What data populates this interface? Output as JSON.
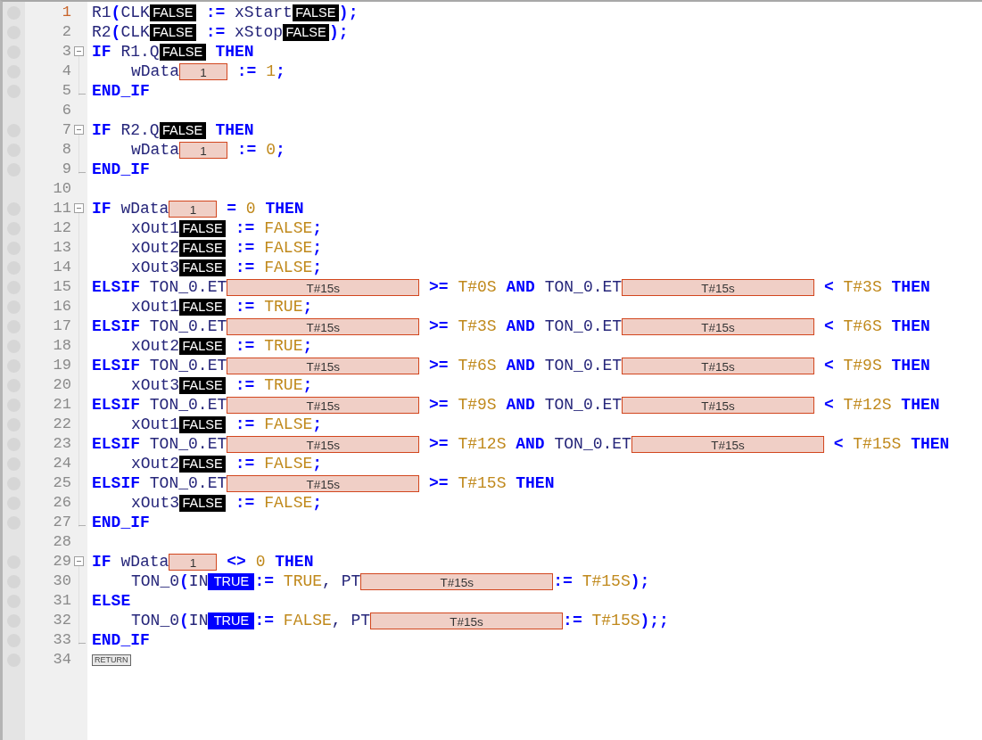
{
  "lines": [
    {
      "number": "1",
      "current": true,
      "kind": "plain",
      "indented": false,
      "tokens": [
        {
          "kind": "id",
          "text": "R1"
        },
        {
          "kind": "op",
          "text": "("
        },
        {
          "kind": "id",
          "text": "CLK"
        },
        {
          "kind": "bool",
          "text": "FALSE",
          "on": false
        },
        {
          "kind": "op",
          "text": " := "
        },
        {
          "kind": "id",
          "text": "xStart"
        },
        {
          "kind": "bool",
          "text": "FALSE",
          "on": false
        },
        {
          "kind": "op",
          "text": ");"
        }
      ]
    },
    {
      "number": "2",
      "current": false,
      "kind": "plain",
      "indented": false,
      "tokens": [
        {
          "kind": "id",
          "text": "R2"
        },
        {
          "kind": "op",
          "text": "("
        },
        {
          "kind": "id",
          "text": "CLK"
        },
        {
          "kind": "bool",
          "text": "FALSE",
          "on": false
        },
        {
          "kind": "op",
          "text": " := "
        },
        {
          "kind": "id",
          "text": "xStop"
        },
        {
          "kind": "bool",
          "text": "FALSE",
          "on": false
        },
        {
          "kind": "op",
          "text": ");"
        }
      ]
    },
    {
      "number": "3",
      "current": false,
      "kind": "open",
      "indented": false,
      "tokens": [
        {
          "kind": "kw",
          "text": "IF"
        },
        {
          "kind": "id",
          "text": " R1.Q"
        },
        {
          "kind": "bool",
          "text": "FALSE",
          "on": false
        },
        {
          "kind": "kw",
          "text": " THEN"
        }
      ]
    },
    {
      "number": "4",
      "current": false,
      "kind": "inner",
      "indented": true,
      "tokens": [
        {
          "kind": "id",
          "text": "wData"
        },
        {
          "kind": "int",
          "text": "1"
        },
        {
          "kind": "op",
          "text": " := "
        },
        {
          "kind": "lit",
          "text": "1"
        },
        {
          "kind": "op",
          "text": ";"
        }
      ]
    },
    {
      "number": "5",
      "current": false,
      "kind": "close",
      "indented": false,
      "tokens": [
        {
          "kind": "kw",
          "text": "END_IF"
        }
      ]
    },
    {
      "number": "6",
      "current": false,
      "kind": "plain"
    },
    {
      "number": "7",
      "current": false,
      "kind": "open",
      "indented": false,
      "tokens": [
        {
          "kind": "kw",
          "text": "IF"
        },
        {
          "kind": "id",
          "text": " R2.Q"
        },
        {
          "kind": "bool",
          "text": "FALSE",
          "on": false
        },
        {
          "kind": "kw",
          "text": " THEN"
        }
      ]
    },
    {
      "number": "8",
      "current": false,
      "kind": "inner",
      "indented": true,
      "tokens": [
        {
          "kind": "id",
          "text": "wData"
        },
        {
          "kind": "int",
          "text": "1"
        },
        {
          "kind": "op",
          "text": " := "
        },
        {
          "kind": "lit",
          "text": "0"
        },
        {
          "kind": "op",
          "text": ";"
        }
      ]
    },
    {
      "number": "9",
      "current": false,
      "kind": "close",
      "indented": false,
      "tokens": [
        {
          "kind": "kw",
          "text": "END_IF"
        }
      ]
    },
    {
      "number": "10",
      "current": false,
      "kind": "plain"
    },
    {
      "number": "11",
      "current": false,
      "kind": "open",
      "indented": false,
      "tokens": [
        {
          "kind": "kw",
          "text": "IF"
        },
        {
          "kind": "id",
          "text": " wData"
        },
        {
          "kind": "int",
          "text": "1"
        },
        {
          "kind": "op",
          "text": " = "
        },
        {
          "kind": "lit",
          "text": "0"
        },
        {
          "kind": "kw",
          "text": " THEN"
        }
      ]
    },
    {
      "number": "12",
      "current": false,
      "kind": "inner",
      "indented": true,
      "tokens": [
        {
          "kind": "id",
          "text": "xOut1"
        },
        {
          "kind": "bool",
          "text": "FALSE",
          "on": false
        },
        {
          "kind": "op",
          "text": " := "
        },
        {
          "kind": "lit",
          "text": "FALSE"
        },
        {
          "kind": "op",
          "text": ";"
        }
      ]
    },
    {
      "number": "13",
      "current": false,
      "kind": "inner",
      "indented": true,
      "tokens": [
        {
          "kind": "id",
          "text": "xOut2"
        },
        {
          "kind": "bool",
          "text": "FALSE",
          "on": false
        },
        {
          "kind": "op",
          "text": " := "
        },
        {
          "kind": "lit",
          "text": "FALSE"
        },
        {
          "kind": "op",
          "text": ";"
        }
      ]
    },
    {
      "number": "14",
      "current": false,
      "kind": "inner",
      "indented": true,
      "tokens": [
        {
          "kind": "id",
          "text": "xOut3"
        },
        {
          "kind": "bool",
          "text": "FALSE",
          "on": false
        },
        {
          "kind": "op",
          "text": " := "
        },
        {
          "kind": "lit",
          "text": "FALSE"
        },
        {
          "kind": "op",
          "text": ";"
        }
      ]
    },
    {
      "number": "15",
      "current": false,
      "kind": "inner",
      "indented": false,
      "tokens": [
        {
          "kind": "kw",
          "text": "ELSIF"
        },
        {
          "kind": "id",
          "text": " TON_0.ET"
        },
        {
          "kind": "time",
          "text": "T#15s"
        },
        {
          "kind": "op",
          "text": " >= "
        },
        {
          "kind": "lit",
          "text": "T#0S"
        },
        {
          "kind": "kw",
          "text": " AND "
        },
        {
          "kind": "id",
          "text": "TON_0.ET"
        },
        {
          "kind": "time",
          "text": "T#15s"
        },
        {
          "kind": "op",
          "text": " < "
        },
        {
          "kind": "lit",
          "text": "T#3S"
        },
        {
          "kind": "kw",
          "text": " THEN"
        }
      ]
    },
    {
      "number": "16",
      "current": false,
      "kind": "inner",
      "indented": true,
      "tokens": [
        {
          "kind": "id",
          "text": "xOut1"
        },
        {
          "kind": "bool",
          "text": "FALSE",
          "on": false
        },
        {
          "kind": "op",
          "text": " := "
        },
        {
          "kind": "lit",
          "text": "TRUE"
        },
        {
          "kind": "op",
          "text": ";"
        }
      ]
    },
    {
      "number": "17",
      "current": false,
      "kind": "inner",
      "indented": false,
      "tokens": [
        {
          "kind": "kw",
          "text": "ELSIF"
        },
        {
          "kind": "id",
          "text": " TON_0.ET"
        },
        {
          "kind": "time",
          "text": "T#15s"
        },
        {
          "kind": "op",
          "text": " >= "
        },
        {
          "kind": "lit",
          "text": "T#3S"
        },
        {
          "kind": "kw",
          "text": " AND "
        },
        {
          "kind": "id",
          "text": "TON_0.ET"
        },
        {
          "kind": "time",
          "text": "T#15s"
        },
        {
          "kind": "op",
          "text": " < "
        },
        {
          "kind": "lit",
          "text": "T#6S"
        },
        {
          "kind": "kw",
          "text": " THEN"
        }
      ]
    },
    {
      "number": "18",
      "current": false,
      "kind": "inner",
      "indented": true,
      "tokens": [
        {
          "kind": "id",
          "text": "xOut2"
        },
        {
          "kind": "bool",
          "text": "FALSE",
          "on": false
        },
        {
          "kind": "op",
          "text": " := "
        },
        {
          "kind": "lit",
          "text": "TRUE"
        },
        {
          "kind": "op",
          "text": ";"
        }
      ]
    },
    {
      "number": "19",
      "current": false,
      "kind": "inner",
      "indented": false,
      "tokens": [
        {
          "kind": "kw",
          "text": "ELSIF"
        },
        {
          "kind": "id",
          "text": " TON_0.ET"
        },
        {
          "kind": "time",
          "text": "T#15s"
        },
        {
          "kind": "op",
          "text": " >= "
        },
        {
          "kind": "lit",
          "text": "T#6S"
        },
        {
          "kind": "kw",
          "text": " AND "
        },
        {
          "kind": "id",
          "text": "TON_0.ET"
        },
        {
          "kind": "time",
          "text": "T#15s"
        },
        {
          "kind": "op",
          "text": " < "
        },
        {
          "kind": "lit",
          "text": "T#9S"
        },
        {
          "kind": "kw",
          "text": " THEN"
        }
      ]
    },
    {
      "number": "20",
      "current": false,
      "kind": "inner",
      "indented": true,
      "tokens": [
        {
          "kind": "id",
          "text": "xOut3"
        },
        {
          "kind": "bool",
          "text": "FALSE",
          "on": false
        },
        {
          "kind": "op",
          "text": " := "
        },
        {
          "kind": "lit",
          "text": "TRUE"
        },
        {
          "kind": "op",
          "text": ";"
        }
      ]
    },
    {
      "number": "21",
      "current": false,
      "kind": "inner",
      "indented": false,
      "tokens": [
        {
          "kind": "kw",
          "text": "ELSIF"
        },
        {
          "kind": "id",
          "text": " TON_0.ET"
        },
        {
          "kind": "time",
          "text": "T#15s"
        },
        {
          "kind": "op",
          "text": " >= "
        },
        {
          "kind": "lit",
          "text": "T#9S"
        },
        {
          "kind": "kw",
          "text": " AND "
        },
        {
          "kind": "id",
          "text": "TON_0.ET"
        },
        {
          "kind": "time",
          "text": "T#15s"
        },
        {
          "kind": "op",
          "text": " < "
        },
        {
          "kind": "lit",
          "text": "T#12S"
        },
        {
          "kind": "kw",
          "text": " THEN"
        }
      ]
    },
    {
      "number": "22",
      "current": false,
      "kind": "inner",
      "indented": true,
      "tokens": [
        {
          "kind": "id",
          "text": "xOut1"
        },
        {
          "kind": "bool",
          "text": "FALSE",
          "on": false
        },
        {
          "kind": "op",
          "text": " := "
        },
        {
          "kind": "lit",
          "text": "FALSE"
        },
        {
          "kind": "op",
          "text": ";"
        }
      ]
    },
    {
      "number": "23",
      "current": false,
      "kind": "inner",
      "indented": false,
      "tokens": [
        {
          "kind": "kw",
          "text": "ELSIF"
        },
        {
          "kind": "id",
          "text": " TON_0.ET"
        },
        {
          "kind": "time",
          "text": "T#15s"
        },
        {
          "kind": "op",
          "text": " >= "
        },
        {
          "kind": "lit",
          "text": "T#12S"
        },
        {
          "kind": "kw",
          "text": " AND "
        },
        {
          "kind": "id",
          "text": "TON_0.ET"
        },
        {
          "kind": "time",
          "text": "T#15s"
        },
        {
          "kind": "op",
          "text": " < "
        },
        {
          "kind": "lit",
          "text": "T#15S"
        },
        {
          "kind": "kw",
          "text": " THEN"
        }
      ]
    },
    {
      "number": "24",
      "current": false,
      "kind": "inner",
      "indented": true,
      "tokens": [
        {
          "kind": "id",
          "text": "xOut2"
        },
        {
          "kind": "bool",
          "text": "FALSE",
          "on": false
        },
        {
          "kind": "op",
          "text": " := "
        },
        {
          "kind": "lit",
          "text": "FALSE"
        },
        {
          "kind": "op",
          "text": ";"
        }
      ]
    },
    {
      "number": "25",
      "current": false,
      "kind": "inner",
      "indented": false,
      "tokens": [
        {
          "kind": "kw",
          "text": "ELSIF"
        },
        {
          "kind": "id",
          "text": " TON_0.ET"
        },
        {
          "kind": "time",
          "text": "T#15s"
        },
        {
          "kind": "op",
          "text": " >= "
        },
        {
          "kind": "lit",
          "text": "T#15S"
        },
        {
          "kind": "kw",
          "text": " THEN"
        }
      ]
    },
    {
      "number": "26",
      "current": false,
      "kind": "inner",
      "indented": true,
      "tokens": [
        {
          "kind": "id",
          "text": "xOut3"
        },
        {
          "kind": "bool",
          "text": "FALSE",
          "on": false
        },
        {
          "kind": "op",
          "text": " := "
        },
        {
          "kind": "lit",
          "text": "FALSE"
        },
        {
          "kind": "op",
          "text": ";"
        }
      ]
    },
    {
      "number": "27",
      "current": false,
      "kind": "close",
      "indented": false,
      "tokens": [
        {
          "kind": "kw",
          "text": "END_IF"
        }
      ]
    },
    {
      "number": "28",
      "current": false,
      "kind": "plain"
    },
    {
      "number": "29",
      "current": false,
      "kind": "open",
      "indented": false,
      "tokens": [
        {
          "kind": "kw",
          "text": "IF"
        },
        {
          "kind": "id",
          "text": " wData"
        },
        {
          "kind": "int",
          "text": "1"
        },
        {
          "kind": "op",
          "text": " <> "
        },
        {
          "kind": "lit",
          "text": "0"
        },
        {
          "kind": "kw",
          "text": " THEN"
        }
      ]
    },
    {
      "number": "30",
      "current": false,
      "kind": "inner",
      "indented": true,
      "tokens": [
        {
          "kind": "id",
          "text": "TON_0"
        },
        {
          "kind": "op",
          "text": "("
        },
        {
          "kind": "id",
          "text": "IN"
        },
        {
          "kind": "bool",
          "text": "TRUE",
          "on": true
        },
        {
          "kind": "op",
          "text": ":= "
        },
        {
          "kind": "lit",
          "text": "TRUE"
        },
        {
          "kind": "id",
          "text": ", PT"
        },
        {
          "kind": "time",
          "text": "T#15s"
        },
        {
          "kind": "op",
          "text": ":= "
        },
        {
          "kind": "lit",
          "text": "T#15S"
        },
        {
          "kind": "op",
          "text": ");"
        }
      ]
    },
    {
      "number": "31",
      "current": false,
      "kind": "inner",
      "indented": false,
      "tokens": [
        {
          "kind": "kw",
          "text": "ELSE"
        }
      ]
    },
    {
      "number": "32",
      "current": false,
      "kind": "inner",
      "indented": true,
      "tokens": [
        {
          "kind": "id",
          "text": "TON_0"
        },
        {
          "kind": "op",
          "text": "("
        },
        {
          "kind": "id",
          "text": "IN"
        },
        {
          "kind": "bool",
          "text": "TRUE",
          "on": true
        },
        {
          "kind": "op",
          "text": ":= "
        },
        {
          "kind": "lit",
          "text": "FALSE"
        },
        {
          "kind": "id",
          "text": ", PT"
        },
        {
          "kind": "time",
          "text": "T#15s"
        },
        {
          "kind": "op",
          "text": ":= "
        },
        {
          "kind": "lit",
          "text": "T#15S"
        },
        {
          "kind": "op",
          "text": ");;"
        }
      ]
    },
    {
      "number": "33",
      "current": false,
      "kind": "close",
      "indented": false,
      "tokens": [
        {
          "kind": "kw",
          "text": "END_IF"
        }
      ]
    },
    {
      "number": "34",
      "current": false,
      "kind": "plain",
      "indented": false,
      "tokens": [
        {
          "kind": "return",
          "text": "RETURN"
        }
      ]
    }
  ]
}
